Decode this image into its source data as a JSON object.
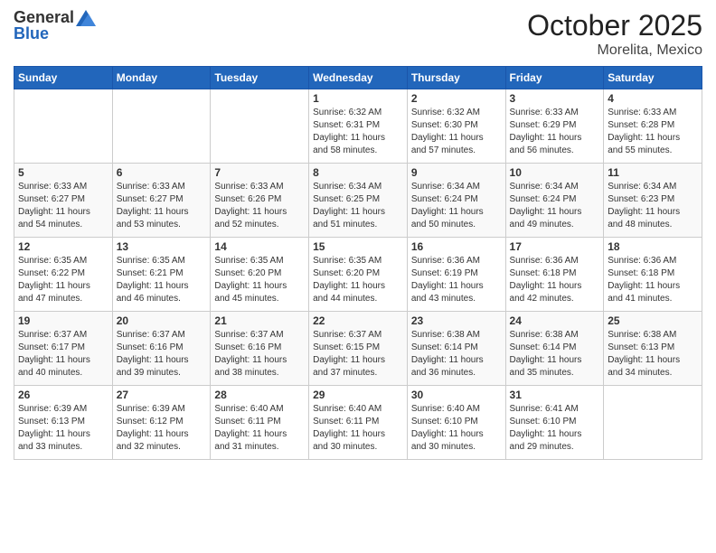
{
  "header": {
    "logo_general": "General",
    "logo_blue": "Blue",
    "month": "October 2025",
    "location": "Morelita, Mexico"
  },
  "days_of_week": [
    "Sunday",
    "Monday",
    "Tuesday",
    "Wednesday",
    "Thursday",
    "Friday",
    "Saturday"
  ],
  "weeks": [
    [
      {
        "day": "",
        "info": ""
      },
      {
        "day": "",
        "info": ""
      },
      {
        "day": "",
        "info": ""
      },
      {
        "day": "1",
        "info": "Sunrise: 6:32 AM\nSunset: 6:31 PM\nDaylight: 11 hours\nand 58 minutes."
      },
      {
        "day": "2",
        "info": "Sunrise: 6:32 AM\nSunset: 6:30 PM\nDaylight: 11 hours\nand 57 minutes."
      },
      {
        "day": "3",
        "info": "Sunrise: 6:33 AM\nSunset: 6:29 PM\nDaylight: 11 hours\nand 56 minutes."
      },
      {
        "day": "4",
        "info": "Sunrise: 6:33 AM\nSunset: 6:28 PM\nDaylight: 11 hours\nand 55 minutes."
      }
    ],
    [
      {
        "day": "5",
        "info": "Sunrise: 6:33 AM\nSunset: 6:27 PM\nDaylight: 11 hours\nand 54 minutes."
      },
      {
        "day": "6",
        "info": "Sunrise: 6:33 AM\nSunset: 6:27 PM\nDaylight: 11 hours\nand 53 minutes."
      },
      {
        "day": "7",
        "info": "Sunrise: 6:33 AM\nSunset: 6:26 PM\nDaylight: 11 hours\nand 52 minutes."
      },
      {
        "day": "8",
        "info": "Sunrise: 6:34 AM\nSunset: 6:25 PM\nDaylight: 11 hours\nand 51 minutes."
      },
      {
        "day": "9",
        "info": "Sunrise: 6:34 AM\nSunset: 6:24 PM\nDaylight: 11 hours\nand 50 minutes."
      },
      {
        "day": "10",
        "info": "Sunrise: 6:34 AM\nSunset: 6:24 PM\nDaylight: 11 hours\nand 49 minutes."
      },
      {
        "day": "11",
        "info": "Sunrise: 6:34 AM\nSunset: 6:23 PM\nDaylight: 11 hours\nand 48 minutes."
      }
    ],
    [
      {
        "day": "12",
        "info": "Sunrise: 6:35 AM\nSunset: 6:22 PM\nDaylight: 11 hours\nand 47 minutes."
      },
      {
        "day": "13",
        "info": "Sunrise: 6:35 AM\nSunset: 6:21 PM\nDaylight: 11 hours\nand 46 minutes."
      },
      {
        "day": "14",
        "info": "Sunrise: 6:35 AM\nSunset: 6:20 PM\nDaylight: 11 hours\nand 45 minutes."
      },
      {
        "day": "15",
        "info": "Sunrise: 6:35 AM\nSunset: 6:20 PM\nDaylight: 11 hours\nand 44 minutes."
      },
      {
        "day": "16",
        "info": "Sunrise: 6:36 AM\nSunset: 6:19 PM\nDaylight: 11 hours\nand 43 minutes."
      },
      {
        "day": "17",
        "info": "Sunrise: 6:36 AM\nSunset: 6:18 PM\nDaylight: 11 hours\nand 42 minutes."
      },
      {
        "day": "18",
        "info": "Sunrise: 6:36 AM\nSunset: 6:18 PM\nDaylight: 11 hours\nand 41 minutes."
      }
    ],
    [
      {
        "day": "19",
        "info": "Sunrise: 6:37 AM\nSunset: 6:17 PM\nDaylight: 11 hours\nand 40 minutes."
      },
      {
        "day": "20",
        "info": "Sunrise: 6:37 AM\nSunset: 6:16 PM\nDaylight: 11 hours\nand 39 minutes."
      },
      {
        "day": "21",
        "info": "Sunrise: 6:37 AM\nSunset: 6:16 PM\nDaylight: 11 hours\nand 38 minutes."
      },
      {
        "day": "22",
        "info": "Sunrise: 6:37 AM\nSunset: 6:15 PM\nDaylight: 11 hours\nand 37 minutes."
      },
      {
        "day": "23",
        "info": "Sunrise: 6:38 AM\nSunset: 6:14 PM\nDaylight: 11 hours\nand 36 minutes."
      },
      {
        "day": "24",
        "info": "Sunrise: 6:38 AM\nSunset: 6:14 PM\nDaylight: 11 hours\nand 35 minutes."
      },
      {
        "day": "25",
        "info": "Sunrise: 6:38 AM\nSunset: 6:13 PM\nDaylight: 11 hours\nand 34 minutes."
      }
    ],
    [
      {
        "day": "26",
        "info": "Sunrise: 6:39 AM\nSunset: 6:13 PM\nDaylight: 11 hours\nand 33 minutes."
      },
      {
        "day": "27",
        "info": "Sunrise: 6:39 AM\nSunset: 6:12 PM\nDaylight: 11 hours\nand 32 minutes."
      },
      {
        "day": "28",
        "info": "Sunrise: 6:40 AM\nSunset: 6:11 PM\nDaylight: 11 hours\nand 31 minutes."
      },
      {
        "day": "29",
        "info": "Sunrise: 6:40 AM\nSunset: 6:11 PM\nDaylight: 11 hours\nand 30 minutes."
      },
      {
        "day": "30",
        "info": "Sunrise: 6:40 AM\nSunset: 6:10 PM\nDaylight: 11 hours\nand 30 minutes."
      },
      {
        "day": "31",
        "info": "Sunrise: 6:41 AM\nSunset: 6:10 PM\nDaylight: 11 hours\nand 29 minutes."
      },
      {
        "day": "",
        "info": ""
      }
    ]
  ]
}
